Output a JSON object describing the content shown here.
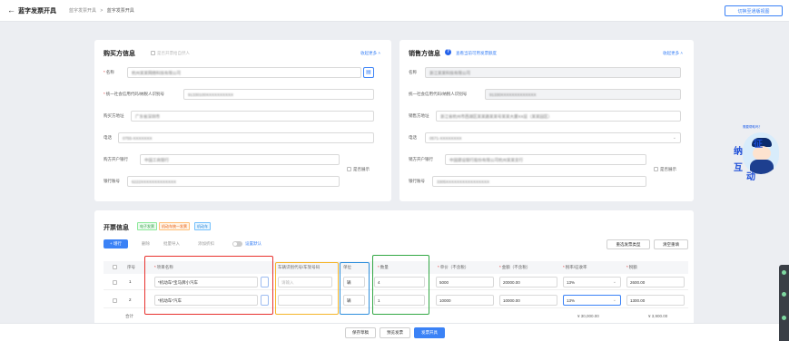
{
  "header": {
    "title": "蓝字发票开具",
    "breadcrumbs": [
      "蓝字发票开具",
      ">",
      "蓝字发票开具"
    ],
    "switch_label": "切换至通版视图"
  },
  "buyer": {
    "title": "购买方信息",
    "natural_person": "是否开票给自然人",
    "fold": "收起更多 ˄",
    "fields": [
      {
        "label": "名称",
        "required": "*",
        "value": "杭州某某网络科技有限公司"
      },
      {
        "label": "统一社会信用代码/纳税人识别号",
        "required": "*",
        "value": "91330100XXXXXXXXXX"
      },
      {
        "label": "购买方地址",
        "value": "广东省深圳市"
      },
      {
        "label": "电话",
        "value": "0755-XXXXXXX"
      },
      {
        "label": "购方开户银行",
        "value": "中国工商银行"
      },
      {
        "label": "银行账号",
        "value": "6222XXXXXXXXXXXXX"
      }
    ],
    "show_flag": "是否展示"
  },
  "seller": {
    "title": "销售方信息",
    "help_icon": "?",
    "hint": "查看当前可用发票额度",
    "fold": "收起更多 ˄",
    "fields": [
      {
        "label": "名称",
        "value": "浙江某某科技有限公司"
      },
      {
        "label": "统一社会信用代码/纳税人识别号",
        "value": "91330XXXXXXXXXXXXX"
      },
      {
        "label": "销售方地址",
        "value": "浙江省杭州市西湖区某某路某某号某某大厦XX层（某某园区）"
      },
      {
        "label": "电话",
        "value": "0571-XXXXXXXX"
      },
      {
        "label": "销方开户银行",
        "value": "中国建设银行股份有限公司杭州某某支行"
      },
      {
        "label": "银行账号",
        "value": "3305XXXXXXXXXXXXXXXX"
      }
    ],
    "show_flag": "是否展示"
  },
  "invoice": {
    "title": "开票信息",
    "tags": [
      "电子发票",
      "机动车统一发票",
      "机动车"
    ],
    "toolbar": {
      "add": "+ 增行",
      "delete": "删除",
      "batch_import": "批量导入",
      "add_discount": "添加折扣",
      "toggle_label": "设置默认",
      "reselect": "重选发票类型",
      "clear": "清空重填"
    },
    "columns": {
      "seq": "序号",
      "item": "项目名称",
      "vin": "车辆识别代号/车架号码",
      "unit": "单位",
      "qty": "数量",
      "price": "单价（不含税）",
      "amount": "金额（不含税）",
      "rate": "税率/征收率",
      "tax": "税额"
    },
    "required_mark": "*",
    "rows": [
      {
        "seq": "1",
        "item": "*机动车*宝马牌小汽车",
        "vin": "请输入",
        "unit": "辆",
        "qty": "4",
        "price": "5000",
        "amount": "20000.00",
        "rate": "13%",
        "tax": "2600.00"
      },
      {
        "seq": "2",
        "item": "*机动车*汽车",
        "vin": "",
        "unit": "辆",
        "qty": "1",
        "price": "10000",
        "amount": "10000.00",
        "rate": "13%",
        "tax": "1300.00"
      }
    ],
    "totals": {
      "label": "合计",
      "amount": "¥ 30,000.00",
      "tax": "¥ 3,900.00"
    }
  },
  "footer": {
    "save_draft": "保存草稿",
    "preview": "预览发票",
    "issue": "发票开具"
  },
  "widget": {
    "hint": "需要帮助吗？",
    "chars": [
      "纳",
      "征",
      "互",
      "动"
    ]
  },
  "colors": {
    "primary": "#3b82f6",
    "highlight_red": "#e8322e",
    "highlight_yellow": "#f5b52b",
    "highlight_blue": "#2f8fdc",
    "highlight_green": "#33a845"
  }
}
